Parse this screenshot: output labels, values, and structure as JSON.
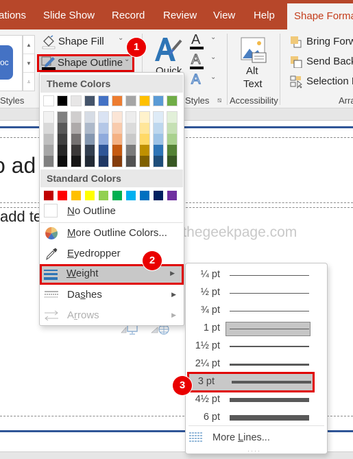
{
  "tabs": [
    {
      "label": "ations",
      "active": false
    },
    {
      "label": "Slide Show",
      "active": false
    },
    {
      "label": "Record",
      "active": false
    },
    {
      "label": "Review",
      "active": false
    },
    {
      "label": "View",
      "active": false
    },
    {
      "label": "Help",
      "active": false
    },
    {
      "label": "Shape Forma",
      "active": true
    }
  ],
  "ribbon": {
    "style_gallery_sample": "oc",
    "shape_fill": "Shape Fill",
    "shape_outline": "Shape Outline",
    "quick_styles": "Quick",
    "alt_text_line1": "Alt",
    "alt_text_line2": "Text",
    "bring_forward": "Bring Forw",
    "send_backward": "Send Back",
    "selection_pane": "Selection P",
    "groups": {
      "shape_styles": "Styles",
      "wordart_styles": "Styles",
      "accessibility": "Accessibility",
      "arrange": "Arra"
    }
  },
  "badges": [
    "1",
    "2",
    "3"
  ],
  "slide": {
    "title_fragment": "o ad",
    "body_fragment": "add te",
    "watermark": "@thegeekpage.com"
  },
  "outline_menu": {
    "theme_colors_header": "Theme Colors",
    "theme_colors": [
      "#ffffff",
      "#000000",
      "#e7e6e6",
      "#44546a",
      "#4472c4",
      "#ed7d31",
      "#a5a5a5",
      "#ffc000",
      "#5b9bd5",
      "#70ad47"
    ],
    "theme_shades": [
      [
        "#f2f2f2",
        "#d9d9d9",
        "#bfbfbf",
        "#a6a6a6",
        "#808080"
      ],
      [
        "#808080",
        "#595959",
        "#404040",
        "#262626",
        "#0d0d0d"
      ],
      [
        "#d0cece",
        "#aeaaaa",
        "#757171",
        "#3b3838",
        "#171616"
      ],
      [
        "#d6dce5",
        "#adb9ca",
        "#8497b0",
        "#333f50",
        "#222a35"
      ],
      [
        "#dae3f3",
        "#b4c7e7",
        "#8faadc",
        "#2f5597",
        "#203864"
      ],
      [
        "#fbe5d6",
        "#f8cbad",
        "#f4b183",
        "#c55a11",
        "#843c0c"
      ],
      [
        "#ededed",
        "#dbdbdb",
        "#c9c9c9",
        "#7b7b7b",
        "#525252"
      ],
      [
        "#fff2cc",
        "#ffe699",
        "#ffd966",
        "#bf9000",
        "#7f6000"
      ],
      [
        "#deebf7",
        "#bdd7ee",
        "#9dc3e6",
        "#2e75b6",
        "#1f4e79"
      ],
      [
        "#e2f0d9",
        "#c5e0b4",
        "#a9d18e",
        "#548235",
        "#385723"
      ]
    ],
    "standard_colors_header": "Standard Colors",
    "standard_colors": [
      "#c00000",
      "#ff0000",
      "#ffc000",
      "#ffff00",
      "#92d050",
      "#00b050",
      "#00b0f0",
      "#0070c0",
      "#002060",
      "#7030a0"
    ],
    "items": {
      "no_outline": {
        "accel": "N",
        "rest": "o Outline"
      },
      "more_colors": {
        "accel": "M",
        "rest": "ore Outline Colors..."
      },
      "eyedropper": {
        "accel": "E",
        "rest": "yedropper"
      },
      "weight": {
        "accel": "W",
        "rest": "eight"
      },
      "dashes": {
        "pre": "Da",
        "accel": "s",
        "rest": "hes"
      },
      "arrows": {
        "pre": "A",
        "accel": "r",
        "rest": "rows"
      }
    }
  },
  "weight_menu": {
    "options": [
      {
        "label": "¼ pt",
        "pt": 0.25
      },
      {
        "label": "½ pt",
        "pt": 0.5
      },
      {
        "label": "¾ pt",
        "pt": 0.75
      },
      {
        "label": "1 pt",
        "pt": 1,
        "current": true
      },
      {
        "label": "1½ pt",
        "pt": 1.5
      },
      {
        "label": "2¼ pt",
        "pt": 2.25
      },
      {
        "label": "3 pt",
        "pt": 3,
        "highlighted": true
      },
      {
        "label": "4½ pt",
        "pt": 4.5
      },
      {
        "label": "6 pt",
        "pt": 6
      }
    ],
    "more_lines": {
      "pre": "More ",
      "accel": "L",
      "rest": "ines..."
    }
  }
}
